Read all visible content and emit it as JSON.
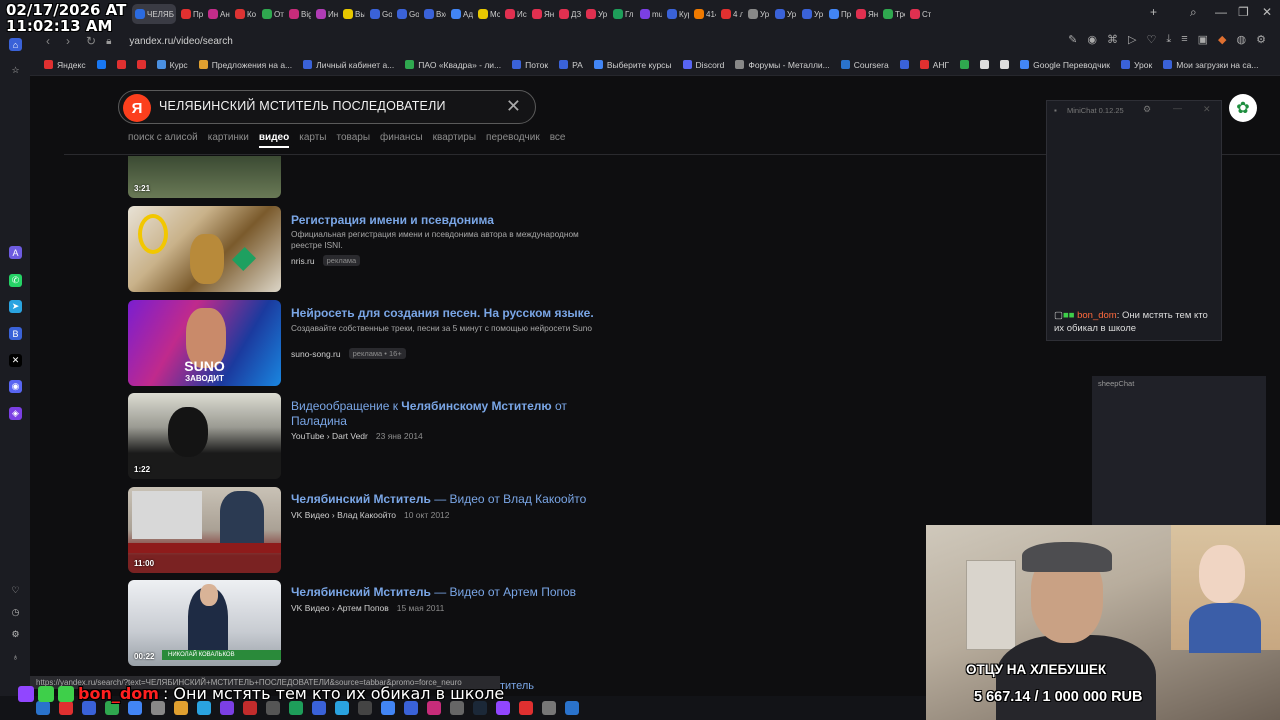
{
  "overlay": {
    "date": "02/17/2026 AT",
    "time": "11:02:13 AM",
    "chat_user": "bon_dom",
    "chat_message": ": Они мстять тем кто их обикал в школе",
    "goal_title": "ОТЦУ НА ХЛЕБУШЕК",
    "goal_amount": "5 667.14 / 1 000 000 RUB"
  },
  "browser": {
    "active_tab_label": "ЧЕЛЯБ",
    "tabs": [
      "Пр",
      "Ан",
      "Ко",
      "От",
      "Big",
      "Ин",
      "Вы",
      "Go",
      "Go",
      "Вхо",
      "Ад",
      "Мс",
      "Ис",
      "Ян",
      "ДЗ",
      "Ур",
      "Гл",
      "mu",
      "Кур",
      "414",
      "4 л",
      "Ур",
      "Ур",
      "Ур",
      "Пр",
      "Ян",
      "Тре",
      "Ст"
    ],
    "url": "yandex.ru/video/search",
    "bookmarks": [
      "Яндекс",
      "Курс",
      "Предложения на а...",
      "Личный кабинет а...",
      "ПАО «Квадра» - ли...",
      "Поток",
      "РА",
      "Выберите курсы",
      "Discord",
      "Форумы - Металли...",
      "Coursera",
      "АНГ",
      "Google Переводчик",
      "Урок",
      "Мои загрузки на са..."
    ],
    "status_url": "https://yandex.ru/search/?text=ЧЕЛЯБИНСКИЙ+МСТИТЕЛЬ+ПОСЛЕДОВАТЕЛИ&source=tabbar&promo=force_neuro"
  },
  "search": {
    "logo": "Я",
    "query": "ЧЕЛЯБИНСКИЙ МСТИТЕЛЬ ПОСЛЕДОВАТЕЛИ",
    "tabs": [
      "поиск с алисой",
      "картинки",
      "видео",
      "карты",
      "товары",
      "финансы",
      "квартиры",
      "переводчик",
      "все"
    ],
    "active_tab": "видео"
  },
  "results": [
    {
      "duration": "3:21"
    },
    {
      "title": "Регистрация имени и псевдонима",
      "desc": "Официальная регистрация имени и псевдонима автора в международном реестре ISNI.",
      "source": "nris.ru",
      "badge": "реклама"
    },
    {
      "title": "Нейросеть для создания песен. На русском языке.",
      "desc": "Создавайте собственные треки, песни за 5 минут с помощью нейросети Suno",
      "source": "suno-song.ru",
      "badge": "реклама • 16+",
      "thumb_text_1": "SUNO",
      "thumb_text_2": "ЗАВОДИТ"
    },
    {
      "title_plain": "Видеообращение к ",
      "title_bold": "Челябинскому Мстителю",
      "title_rest": " от Паладина",
      "source": "YouTube › Dart Vedr",
      "date": "23 янв 2014",
      "duration": "1:22"
    },
    {
      "title_bold": "Челябинский Мститель",
      "title_rest": " — Видео от Влад Какоойто",
      "source": "VK Видео › Влад Какоойто",
      "date": "10 окт 2012",
      "duration": "11:00"
    },
    {
      "title_bold": "Челябинский Мститель",
      "title_rest": " — Видео от Артем Попов",
      "source": "VK Видео › Артем Попов",
      "date": "15 мая 2011",
      "duration": "00:22",
      "thumb_caption": "НИКОЛАЙ КОВАЛЬКОВ"
    }
  ],
  "partial_result_title": "титель",
  "minichat": {
    "title": "MiniChat 0.12.25",
    "user": "bon_dom",
    "message": ": Они мстять тем кто их обикал в школе"
  },
  "sheepchat": {
    "title": "sheepChat"
  },
  "colors": {
    "yandex_red": "#fc3f1d",
    "link_blue": "#7aa6e6",
    "background": "#0e0e10"
  }
}
